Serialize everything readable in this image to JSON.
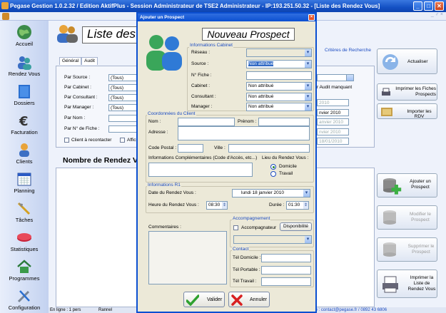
{
  "window": {
    "title": "Pegase Gestion 1.0.2.32 / Edition AktifPlus - Session Administrateur de TSE2 Administrateur - IP:193.251.50.32 - [Liste des Rendez Vous]",
    "min": "_",
    "max": "□",
    "close": "✕",
    "menu_right": "_ ♂ ×"
  },
  "sidebar": [
    {
      "label": "Accueil"
    },
    {
      "label": "Rendez Vous"
    },
    {
      "label": "Dossiers"
    },
    {
      "label": "Facturation"
    },
    {
      "label": "Clients"
    },
    {
      "label": "Planning"
    },
    {
      "label": "Tâches"
    },
    {
      "label": "Statistiques"
    },
    {
      "label": "Programmes"
    },
    {
      "label": "Configuration"
    }
  ],
  "main": {
    "title": "Liste des Re",
    "tabs": [
      "Général",
      "Audit"
    ],
    "criteria_link": "Critères de Recherche",
    "filters": [
      {
        "label": "Par Source :",
        "value": "(Tous)"
      },
      {
        "label": "Par Cabinet :",
        "value": "(Tous)"
      },
      {
        "label": "Par Consultant :",
        "value": "(Tous)"
      },
      {
        "label": "Par Manager :",
        "value": "(Tous)"
      },
      {
        "label": "Par Nom :",
        "value": ""
      },
      {
        "label": "Par N° de Fiche :",
        "value": ""
      }
    ],
    "client_reconnect": "Client à recontacter",
    "affich": "Affich",
    "audit_missing": "r Audit manquant",
    "date_fields": [
      "2010",
      "nvier 2010",
      "anvier 2010",
      "nvier 2010",
      "18/01/2010"
    ],
    "count_title": "Nombre de Rendez Vo",
    "status_left": "En ligne : 1 pers",
    "status_mid": "Rannel",
    "status_right": "Support Technique : contact@pegase.fr / 0892 43 6806"
  },
  "right_buttons": [
    {
      "label": "Actualiser"
    },
    {
      "label": "Imprimer les Fiches Prospects"
    },
    {
      "label": "Importer les RDV"
    },
    {
      "label": "Ajouter un Prospect"
    },
    {
      "label": "Modifier le Prospect"
    },
    {
      "label": "Supprimer le Prospect"
    },
    {
      "label": "Imprimer la Liste de Rendez Vous"
    }
  ],
  "modal": {
    "title": "Ajouter un Prospect",
    "heading": "Nouveau Prospect",
    "cabinet": {
      "legend": "Informations Cabinet",
      "reseau_label": "Réseau :",
      "reseau_value": "",
      "source_label": "Source :",
      "source_value": "Non attribué",
      "fiche_label": "N° Fiche :",
      "fiche_value": "",
      "cabinet_label": "Cabinet :",
      "cabinet_value": "Non attribué",
      "consultant_label": "Consultant :",
      "consultant_value": "Non attribué",
      "manager_label": "Manager :",
      "manager_value": "Non attribué"
    },
    "client": {
      "legend": "Coordonnées du Client",
      "nom_label": "Nom :",
      "prenom_label": "Prénom :",
      "adresse_label": "Adresse :",
      "cp_label": "Code Postal :",
      "ville_label": "Ville :",
      "complement_label": "Informations Complémentaires (Code d'Accès, etc...)",
      "lieu_label": "Lieu du Rendez Vous :",
      "lieu_options": [
        "Domicile",
        "Travail"
      ]
    },
    "r1": {
      "legend": "Informations R1",
      "date_label": "Date du Rendez Vous :",
      "date_value": "lundi   18  janvier  2010",
      "heure_label": "Heure du Rendez Vous :",
      "heure_value": "08:30",
      "duree_label": "Durée :",
      "duree_value": "01:30"
    },
    "commentaires_label": "Commentaires :",
    "accompagnement": {
      "legend": "Accompagnement",
      "check_label": "Accompagnateur",
      "button": "Disponibilité"
    },
    "contact": {
      "legend": "Contact",
      "dom_label": "Tél Domicile :",
      "port_label": "Tél Portable :",
      "trav_label": "Tél Travail :"
    },
    "valider": "Valider",
    "annuler": "Annuler"
  }
}
